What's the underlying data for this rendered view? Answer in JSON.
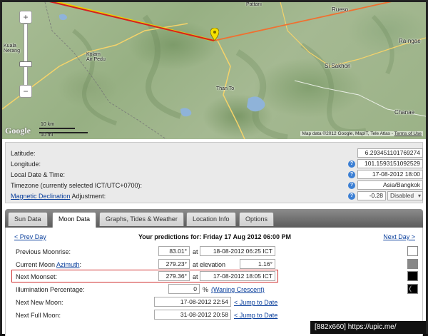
{
  "map": {
    "labels": {
      "rueso": "Rueso",
      "ranga": "Ra-ngae",
      "kuala_nerang": "Kuala\nNerang",
      "kolam": "Kolam\nAir Pedu",
      "si_sakhon": "Si Sakhon",
      "than_to": "Than To",
      "chanae": "Chanae",
      "pattani": "Pattani"
    },
    "scale_top": "10 km",
    "scale_bottom": "10 mi",
    "logo": "Google",
    "credit_prefix": "Map data ©2012 Google, MapIT, Tele Atlas - ",
    "terms": "Terms of Use",
    "zoom_in": "+",
    "zoom_out": "−",
    "colors": {
      "sun_line": "#e8d000",
      "moonrise_line": "#f07030",
      "moonset_line": "#d42020"
    }
  },
  "info": {
    "latitude_label": "Latitude:",
    "latitude_value": "6.293451101769274",
    "longitude_label": "Longitude:",
    "longitude_value": "101.1593151092529",
    "datetime_label": "Local Date & Time:",
    "datetime_value": "17-08-2012 18:00",
    "timezone_label": "Timezone (currently selected ICT/UTC+0700):",
    "timezone_value": "Asia/Bangkok",
    "magdec_link": "Magnetic Declination",
    "magdec_suffix": " Adjustment:",
    "magdec_value": "-0.28",
    "magdec_mode": "Disabled",
    "help": "?"
  },
  "tabs": [
    {
      "label": "Sun Data",
      "active": false
    },
    {
      "label": "Moon Data",
      "active": true
    },
    {
      "label": "Graphs, Tides & Weather",
      "active": false
    },
    {
      "label": "Location Info",
      "active": false
    },
    {
      "label": "Options",
      "active": false
    }
  ],
  "moon": {
    "prev_day": "< Prev Day",
    "next_day": "Next Day >",
    "title": "Your predictions for: Friday 17 Aug 2012 06:00 PM",
    "at": "at",
    "at_elevation": "at elevation",
    "percent": "%",
    "rows": {
      "prev_moonrise": {
        "label": "Previous Moonrise:",
        "angle": "83.01°",
        "time": "18-08-2012 06:25 ICT"
      },
      "current_azimuth": {
        "label_prefix": "Current Moon ",
        "label_link": "Azimuth",
        "label_suffix": ":",
        "angle": "279.23°",
        "elevation": "1.16°"
      },
      "next_moonset": {
        "label": "Next Moonset:",
        "angle": "279.36°",
        "time": "17-08-2012 18:05 ICT"
      },
      "illumination": {
        "label": "Illumination Percentage:",
        "value": "0",
        "phase": "(Waning Crescent)"
      },
      "next_new_moon": {
        "label": "Next New Moon:",
        "time": "17-08-2012 22:54",
        "jump": "< Jump to Date"
      },
      "next_full_moon": {
        "label": "Next Full Moon:",
        "time": "31-08-2012 20:58",
        "jump": "< Jump to Date"
      }
    },
    "swatches": [
      "#ffffff",
      "#888888",
      "#000000",
      "#000000"
    ]
  },
  "watermark": "[882x660] https://upic.me/"
}
